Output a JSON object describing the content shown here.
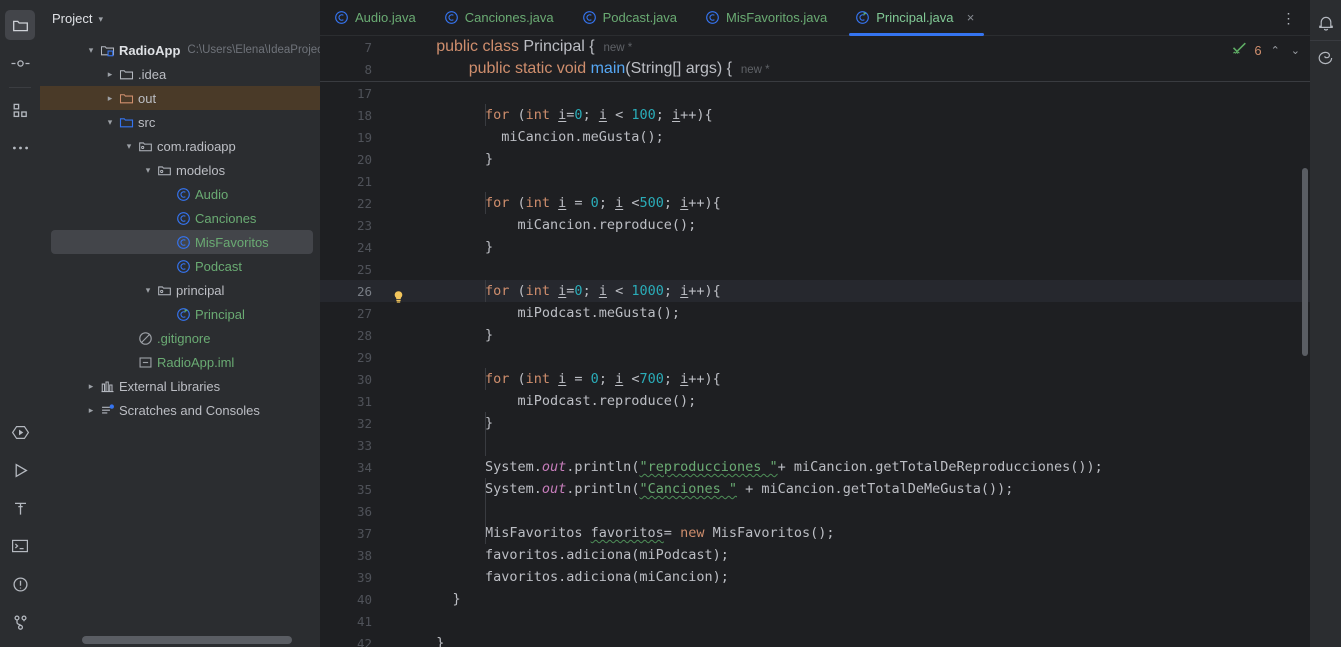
{
  "window": {
    "theme_bg": "#1e1f22",
    "panel_bg": "#2b2d30",
    "accent": "#3574f0"
  },
  "activity_bar": {
    "top_items": [
      {
        "name": "project-icon",
        "label": "Project",
        "active": true
      },
      {
        "name": "commit-icon",
        "label": "Commit",
        "active": false
      },
      {
        "name": "structure-icon",
        "label": "Structure",
        "active": false
      },
      {
        "name": "more-tool-windows-icon",
        "label": "More Tool Windows",
        "active": false
      }
    ],
    "bottom_items": [
      {
        "name": "run-with-coverage-icon",
        "label": "Coverage"
      },
      {
        "name": "run-icon",
        "label": "Run"
      },
      {
        "name": "build-hammer-icon",
        "label": "Build"
      },
      {
        "name": "terminal-icon",
        "label": "Terminal"
      },
      {
        "name": "problems-icon",
        "label": "Problems"
      },
      {
        "name": "git-branch-icon",
        "label": "Version Control"
      }
    ]
  },
  "right_bar": {
    "items": [
      {
        "name": "notifications-bell-icon",
        "label": "Notifications"
      },
      {
        "name": "database-icon",
        "label": "Database"
      }
    ]
  },
  "sidebar": {
    "title": "Project",
    "tree": [
      {
        "depth": 0,
        "arrow": "open",
        "icon": "project-module-icon",
        "label": "RadioApp",
        "style": "bold",
        "path": "C:\\Users\\Elena\\IdeaProjec",
        "selected": ""
      },
      {
        "depth": 1,
        "arrow": "closed",
        "icon": "folder-icon",
        "label": ".idea",
        "style": "plain",
        "path": "",
        "selected": ""
      },
      {
        "depth": 1,
        "arrow": "closed",
        "icon": "folder-orange-icon",
        "label": "out",
        "style": "plain",
        "path": "",
        "selected": "out"
      },
      {
        "depth": 1,
        "arrow": "open",
        "icon": "folder-source-icon",
        "label": "src",
        "style": "plain",
        "path": "",
        "selected": ""
      },
      {
        "depth": 2,
        "arrow": "open",
        "icon": "package-icon",
        "label": "com.radioapp",
        "style": "plain",
        "path": "",
        "selected": ""
      },
      {
        "depth": 3,
        "arrow": "open",
        "icon": "package-icon",
        "label": "modelos",
        "style": "plain",
        "path": "",
        "selected": ""
      },
      {
        "depth": 4,
        "arrow": "none",
        "icon": "java-class-icon",
        "label": "Audio",
        "style": "green",
        "path": "",
        "selected": ""
      },
      {
        "depth": 4,
        "arrow": "none",
        "icon": "java-class-icon",
        "label": "Canciones",
        "style": "green",
        "path": "",
        "selected": ""
      },
      {
        "depth": 4,
        "arrow": "none",
        "icon": "java-class-icon",
        "label": "MisFavoritos",
        "style": "green",
        "path": "",
        "selected": "file"
      },
      {
        "depth": 4,
        "arrow": "none",
        "icon": "java-class-icon",
        "label": "Podcast",
        "style": "green",
        "path": "",
        "selected": ""
      },
      {
        "depth": 3,
        "arrow": "open",
        "icon": "package-icon",
        "label": "principal",
        "style": "plain",
        "path": "",
        "selected": ""
      },
      {
        "depth": 4,
        "arrow": "none",
        "icon": "java-main-class-icon",
        "label": "Principal",
        "style": "green",
        "path": "",
        "selected": ""
      },
      {
        "depth": 2,
        "arrow": "none",
        "icon": "gitignore-icon",
        "label": ".gitignore",
        "style": "green",
        "path": "",
        "selected": ""
      },
      {
        "depth": 2,
        "arrow": "none",
        "icon": "iml-module-icon",
        "label": "RadioApp.iml",
        "style": "green",
        "path": "",
        "selected": ""
      },
      {
        "depth": 0,
        "arrow": "closed",
        "icon": "external-libraries-icon",
        "label": "External Libraries",
        "style": "plain",
        "path": "",
        "selected": ""
      },
      {
        "depth": 0,
        "arrow": "closed",
        "icon": "scratches-icon",
        "label": "Scratches and Consoles",
        "style": "plain",
        "path": "",
        "selected": ""
      }
    ]
  },
  "editor": {
    "tabs": [
      {
        "label": "Audio.java",
        "icon": "java-class-icon",
        "active": false,
        "closable": false
      },
      {
        "label": "Canciones.java",
        "icon": "java-class-icon",
        "active": false,
        "closable": false
      },
      {
        "label": "Podcast.java",
        "icon": "java-class-icon",
        "active": false,
        "closable": false
      },
      {
        "label": "MisFavoritos.java",
        "icon": "java-class-icon",
        "active": false,
        "closable": false
      },
      {
        "label": "Principal.java",
        "icon": "java-main-class-icon",
        "active": true,
        "closable": true
      }
    ],
    "tab_close_glyph": "×",
    "tab_overflow_menu": "⋮",
    "inspection": {
      "status_icon": "inspection-ok-icon",
      "warning_count": "6",
      "prev_glyph": "⌃",
      "next_glyph": "⌄"
    },
    "sticky_lines": [
      {
        "num": "7",
        "hint": "new *"
      },
      {
        "num": "8",
        "hint": "new *"
      }
    ],
    "line_numbers": [
      "17",
      "18",
      "19",
      "20",
      "21",
      "22",
      "23",
      "24",
      "25",
      "26",
      "27",
      "28",
      "29",
      "30",
      "31",
      "32",
      "33",
      "34",
      "35",
      "36",
      "37",
      "38",
      "39",
      "40",
      "41",
      "42"
    ],
    "current_line": "26",
    "gutter_bulb_line": "26",
    "bulb_glyph": "💡",
    "code_text": {
      "l7": "public class Principal {",
      "l8": "public static void main(String[] args) {",
      "l17": "",
      "l18": "for (int i=0; i < 100; i++){",
      "l19": "miCancion.meGusta();",
      "l20": "}",
      "l21": "",
      "l22": "for (int i = 0; i <500; i++){",
      "l23": "miCancion.reproduce();",
      "l24": "}",
      "l25": "",
      "l26": "for (int i=0; i < 1000; i++){",
      "l27": "miPodcast.meGusta();",
      "l28": "}",
      "l29": "",
      "l30": "for (int i = 0; i <700; i++){",
      "l31": "miPodcast.reproduce();",
      "l32": "}",
      "l33": "",
      "l34": "System.out.println(\"reproducciones \"+ miCancion.getTotalDeReproducciones());",
      "l35": "System.out.println(\"Canciones \" + miCancion.getTotalDeMeGusta());",
      "l36": "",
      "l37": "MisFavoritos favoritos= new MisFavoritos();",
      "l38": "favoritos.adiciona(miPodcast);",
      "l39": "favoritos.adiciona(miCancion);",
      "l40": "}",
      "l41": "",
      "l42": "}"
    }
  }
}
